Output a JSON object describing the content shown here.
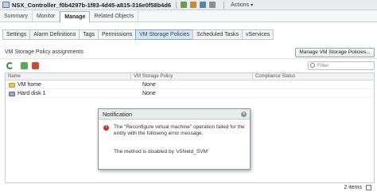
{
  "window": {
    "title": "NSX_Controller_f0b4297b-1f83-4d45-a815-316e0f58b4d6",
    "actions_label": "Actions"
  },
  "main_tabs": [
    {
      "label": "Summary"
    },
    {
      "label": "Monitor"
    },
    {
      "label": "Manage"
    },
    {
      "label": "Related Objects"
    }
  ],
  "sub_tabs": [
    {
      "label": "Settings"
    },
    {
      "label": "Alarm Definitions"
    },
    {
      "label": "Tags"
    },
    {
      "label": "Permissions"
    },
    {
      "label": "VM Storage Policies"
    },
    {
      "label": "Scheduled Tasks"
    },
    {
      "label": "vServices"
    }
  ],
  "section": {
    "title": "VM Storage Policy assignments",
    "manage_button": "Manage VM Storage Policies..."
  },
  "filter": {
    "placeholder": "Filter"
  },
  "grid": {
    "columns": [
      "Name",
      "VM Storage Policy",
      "Compliance Status"
    ],
    "rows": [
      {
        "name": "VM home",
        "policy": "None",
        "status": ""
      },
      {
        "name": "Hard disk 1",
        "policy": "None",
        "status": ""
      }
    ],
    "item_count": "2 items"
  },
  "dialog": {
    "title": "Notification",
    "message": "The \"Reconfigure virtual machine\" operation failed for the entity with the following error message.",
    "detail": "The method is disabled by 'vShield_SVM'"
  },
  "colors": {
    "active_tab": "#d3e6f5",
    "error": "#c8322a"
  }
}
